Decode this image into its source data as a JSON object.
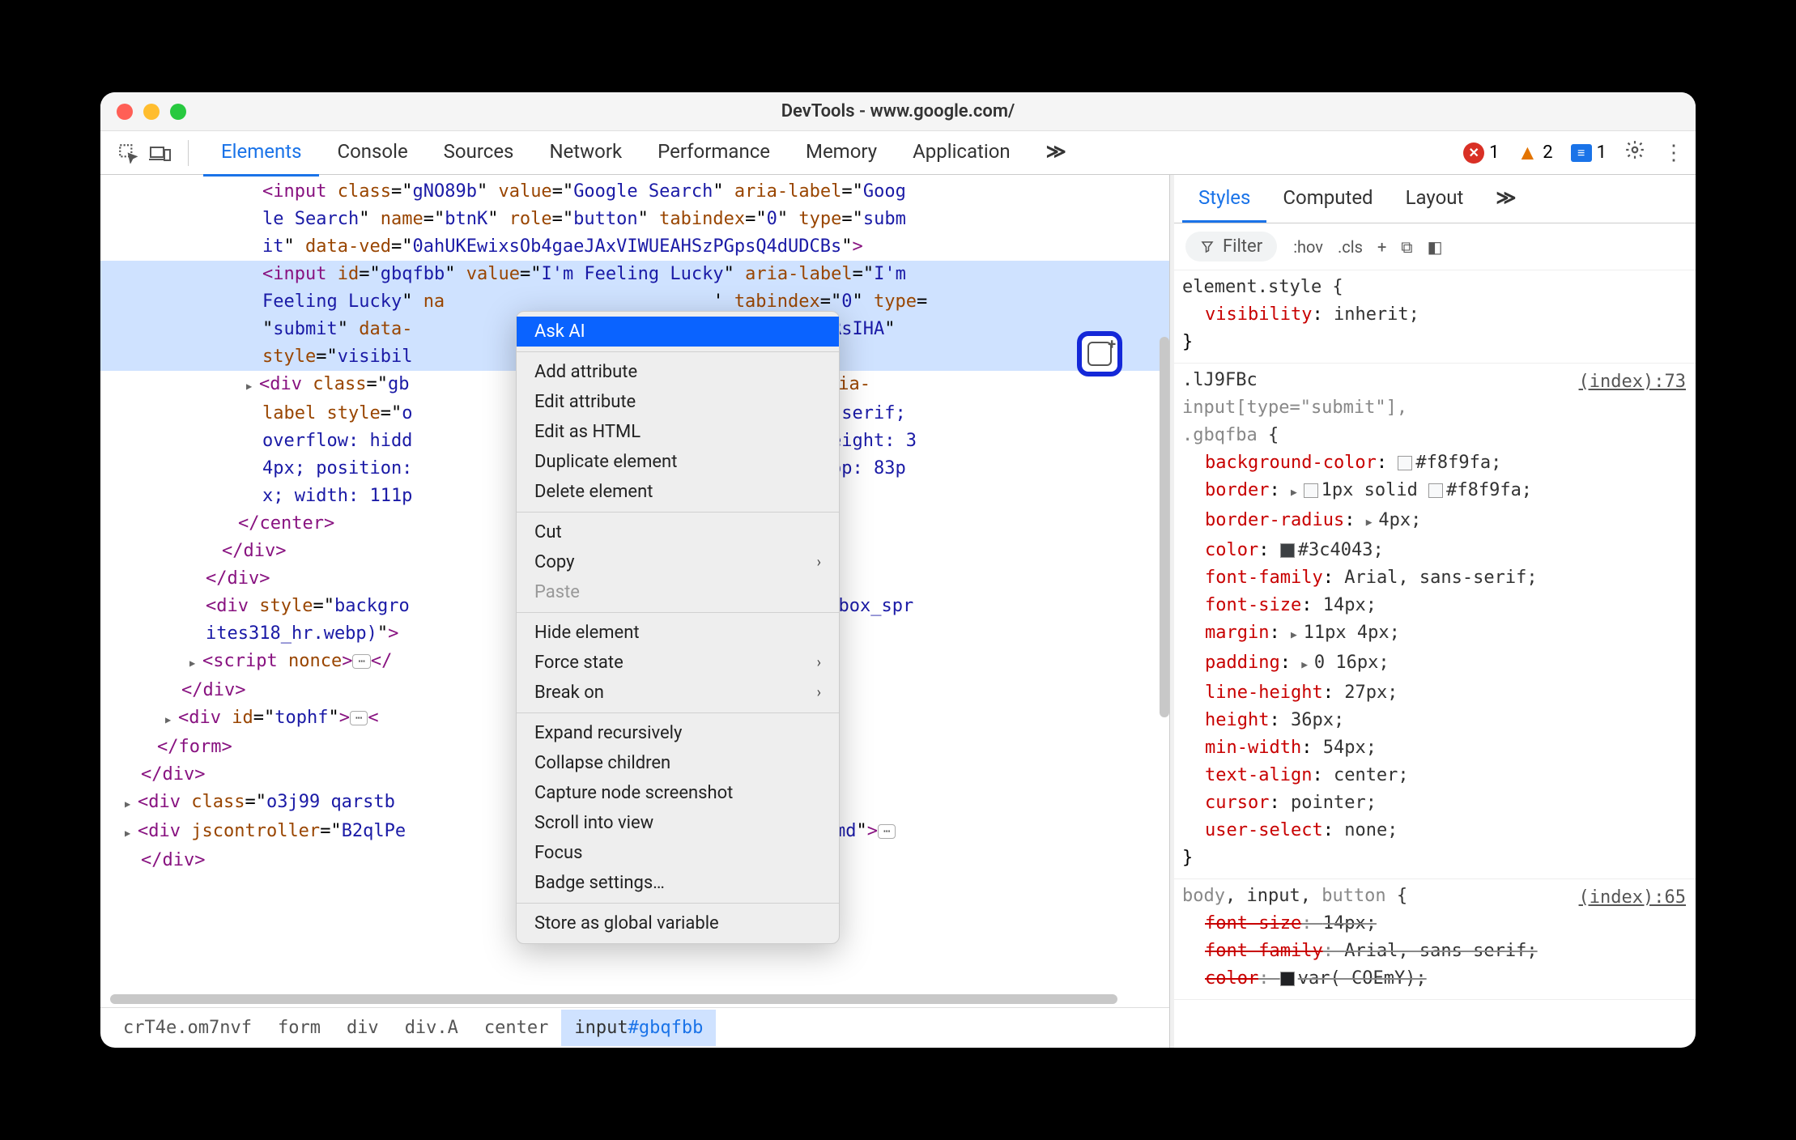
{
  "window": {
    "title": "DevTools - www.google.com/"
  },
  "toolbar": {
    "tabs": [
      "Elements",
      "Console",
      "Sources",
      "Network",
      "Performance",
      "Memory",
      "Application"
    ],
    "active_tab": "Elements",
    "overflow": "≫",
    "errors": 1,
    "warnings": 2,
    "issues": 1
  },
  "dom": {
    "lines": [
      {
        "indent": 200,
        "selected": false,
        "html": "<span class='tok-tag'>&lt;input</span> <span class='tok-attr'>class</span>=\"<span class='tok-val'>gNO89b</span>\" <span class='tok-attr'>value</span>=\"<span class='tok-val'>Google Search</span>\" <span class='tok-attr'>aria-label</span>=\"<span class='tok-val'>Goog</span>"
      },
      {
        "indent": 200,
        "selected": false,
        "html": "<span class='tok-val'>le Search</span>\" <span class='tok-attr'>name</span>=\"<span class='tok-val'>btnK</span>\" <span class='tok-attr'>role</span>=\"<span class='tok-val'>button</span>\" <span class='tok-attr'>tabindex</span>=\"<span class='tok-val'>0</span>\" <span class='tok-attr'>type</span>=\"<span class='tok-val'>subm</span>"
      },
      {
        "indent": 200,
        "selected": false,
        "html": "<span class='tok-val'>it</span>\" <span class='tok-attr'>data-ved</span>=\"<span class='tok-val'>0ahUKEwixsOb4gaeJAxVIWUEAHSzPGpsQ4dUDCBs</span>\"<span class='tok-tag'>&gt;</span>"
      },
      {
        "indent": 200,
        "selected": true,
        "html": "<span class='tok-tag'>&lt;input</span> <span class='tok-attr'>id</span>=\"<span class='tok-val'>gbqfbb</span>\" <span class='tok-attr'>value</span>=\"<span class='tok-val'>I'm Feeling Lucky</span>\" <span class='tok-attr'>aria-label</span>=\"<span class='tok-val'>I'm </span>"
      },
      {
        "indent": 200,
        "selected": true,
        "html": "<span class='tok-val'>Feeling Lucky</span>\" <span class='tok-attr'>na</span>&nbsp;&nbsp;&nbsp;&nbsp;&nbsp;&nbsp;&nbsp;&nbsp;&nbsp;&nbsp;&nbsp;&nbsp;&nbsp;&nbsp;&nbsp;&nbsp;&nbsp;&nbsp;&nbsp;&nbsp;&nbsp;&nbsp;&nbsp;&nbsp;&nbsp;' <span class='tok-attr'>tabindex</span>=\"<span class='tok-val'>0</span>\" <span class='tok-attr'>type</span>="
      },
      {
        "indent": 200,
        "selected": true,
        "html": "\"<span class='tok-val'>submit</span>\" <span class='tok-attr'>data-</span>&nbsp;&nbsp;&nbsp;&nbsp;&nbsp;&nbsp;&nbsp;&nbsp;&nbsp;&nbsp;&nbsp;&nbsp;&nbsp;&nbsp;&nbsp;&nbsp;&nbsp;&nbsp;&nbsp;&nbsp;&nbsp;&nbsp;&nbsp;&nbsp;&nbsp;<span class='tok-val'>IWUEAHSzPGpsQnRsIHA</span>\""
      },
      {
        "indent": 200,
        "selected": true,
        "html": "<span class='tok-attr'>style</span>=\"<span class='tok-val'>visibil</span>"
      },
      {
        "indent": 180,
        "selected": false,
        "html": "<span class='caret'></span><span class='tok-tag'>&lt;div</span> <span class='tok-attr'>class</span>=\"<span class='tok-val'>gb</span>&nbsp;&nbsp;&nbsp;&nbsp;&nbsp;&nbsp;&nbsp;&nbsp;&nbsp;&nbsp;&nbsp;&nbsp;&nbsp;&nbsp;&nbsp;&nbsp;&nbsp;&nbsp;&nbsp;&nbsp;&nbsp;&nbsp;&nbsp;&nbsp;&nbsp;&nbsp;<span class='tok-val'>esentation</span>\" <span class='tok-attr'>aria-</span>"
      },
      {
        "indent": 200,
        "selected": false,
        "html": "<span class='tok-attr'>label</span> <span class='tok-attr'>style</span>=\"<span class='tok-val'>o</span>&nbsp;&nbsp;&nbsp;&nbsp;&nbsp;&nbsp;&nbsp;&nbsp;&nbsp;&nbsp;&nbsp;&nbsp;&nbsp;&nbsp;&nbsp;&nbsp;&nbsp;&nbsp;&nbsp;&nbsp;&nbsp;&nbsp;&nbsp;&nbsp;&nbsp;&nbsp;<span class='tok-val'>: Arial, sans-serif;</span>"
      },
      {
        "indent": 200,
        "selected": false,
        "html": "<span class='tok-val'>overflow: hidd</span>&nbsp;&nbsp;&nbsp;&nbsp;&nbsp;&nbsp;&nbsp;&nbsp;&nbsp;&nbsp;&nbsp;&nbsp;&nbsp;&nbsp;&nbsp;&nbsp;&nbsp;&nbsp;&nbsp;&nbsp;&nbsp;&nbsp;&nbsp;&nbsp;&nbsp;&nbsp;<span class='tok-val'>-index: 50; height: 3</span>"
      },
      {
        "indent": 200,
        "selected": false,
        "html": "<span class='tok-val'>4px; position:</span>&nbsp;&nbsp;&nbsp;&nbsp;&nbsp;&nbsp;&nbsp;&nbsp;&nbsp;&nbsp;&nbsp;&nbsp;&nbsp;&nbsp;&nbsp;&nbsp;&nbsp;&nbsp;&nbsp;&nbsp;&nbsp;&nbsp;&nbsp;&nbsp;&nbsp;&nbsp;<span class='tok-val'>argin: 0px; top: 83p</span>"
      },
      {
        "indent": 200,
        "selected": false,
        "html": "<span class='tok-val'>x; width: 111p</span>"
      },
      {
        "indent": 170,
        "selected": false,
        "html": "<span class='tok-tag'>&lt;/center&gt;</span>"
      },
      {
        "indent": 150,
        "selected": false,
        "html": "<span class='tok-tag'>&lt;/div&gt;</span>"
      },
      {
        "indent": 130,
        "selected": false,
        "html": "<span class='tok-tag'>&lt;/div&gt;</span>"
      },
      {
        "indent": 130,
        "selected": false,
        "html": "<span class='tok-tag'>&lt;div</span> <span class='tok-attr'>style</span>=\"<span class='tok-val'>backgro</span>&nbsp;&nbsp;&nbsp;&nbsp;&nbsp;&nbsp;&nbsp;&nbsp;&nbsp;&nbsp;&nbsp;&nbsp;&nbsp;&nbsp;&nbsp;&nbsp;&nbsp;&nbsp;&nbsp;&nbsp;&nbsp;&nbsp;&nbsp;&nbsp;&nbsp;&nbsp;<span class='tok-val'>desktop_searchbox_spr</span>"
      },
      {
        "indent": 130,
        "selected": false,
        "html": "<span class='tok-val'>ites318_hr.webp)</span>\"<span class='tok-tag'>&gt;</span> <span class='tok-text'></span>"
      },
      {
        "indent": 110,
        "selected": false,
        "html": "<span class='caret'></span><span class='tok-tag'>&lt;script</span> <span class='tok-attr'>nonce</span><span class='tok-tag'>&gt;</span><span class='ell'>⋯</span><span class='tok-tag'>&lt;/</span>"
      },
      {
        "indent": 100,
        "selected": false,
        "html": "<span class='tok-tag'>&lt;/div&gt;</span>"
      },
      {
        "indent": 80,
        "selected": false,
        "html": "<span class='caret'></span><span class='tok-tag'>&lt;div</span> <span class='tok-attr'>id</span>=\"<span class='tok-val'>tophf</span>\"<span class='tok-tag'>&gt;</span><span class='ell'>⋯</span><span class='tok-tag'>&lt;</span>"
      },
      {
        "indent": 70,
        "selected": false,
        "html": "<span class='tok-tag'>&lt;/form&gt;</span>"
      },
      {
        "indent": 50,
        "selected": false,
        "html": "<span class='tok-tag'>&lt;/div&gt;</span>"
      },
      {
        "indent": 30,
        "selected": false,
        "html": "<span class='caret'></span><span class='tok-tag'>&lt;div</span> <span class='tok-attr'>class</span>=\"<span class='tok-val'>o3j99 qarstb</span>"
      },
      {
        "indent": 30,
        "selected": false,
        "html": "<span class='caret'></span><span class='tok-tag'>&lt;div</span> <span class='tok-attr'>jscontroller</span>=\"<span class='tok-val'>B2qlPe</span>&nbsp;&nbsp;&nbsp;&nbsp;&nbsp;&nbsp;&nbsp;&nbsp;&nbsp;&nbsp;&nbsp;&nbsp;&nbsp;&nbsp;&nbsp;&nbsp;&nbsp;&nbsp;&nbsp;&nbsp;&nbsp;&nbsp;&nbsp;&nbsp;&nbsp;&nbsp;<span class='tok-attr'>n</span>=\"<span class='tok-val'>rcuQ6b:npT2md</span>\"<span class='tok-tag'>&gt;</span><span class='ell'>⋯</span>"
      },
      {
        "indent": 50,
        "selected": false,
        "html": "<span class='tok-tag'>&lt;/div&gt;</span>"
      }
    ]
  },
  "context_menu": {
    "items": [
      {
        "label": "Ask AI",
        "state": "highlighted"
      },
      {
        "sep": true
      },
      {
        "label": "Add attribute"
      },
      {
        "label": "Edit attribute"
      },
      {
        "label": "Edit as HTML"
      },
      {
        "label": "Duplicate element"
      },
      {
        "label": "Delete element"
      },
      {
        "sep": true
      },
      {
        "label": "Cut"
      },
      {
        "label": "Copy",
        "submenu": true
      },
      {
        "label": "Paste",
        "state": "disabled"
      },
      {
        "sep": true
      },
      {
        "label": "Hide element"
      },
      {
        "label": "Force state",
        "submenu": true
      },
      {
        "label": "Break on",
        "submenu": true
      },
      {
        "sep": true
      },
      {
        "label": "Expand recursively"
      },
      {
        "label": "Collapse children"
      },
      {
        "label": "Capture node screenshot"
      },
      {
        "label": "Scroll into view"
      },
      {
        "label": "Focus"
      },
      {
        "label": "Badge settings…"
      },
      {
        "sep": true
      },
      {
        "label": "Store as global variable"
      }
    ]
  },
  "breadcrumbs": [
    {
      "text": "crT4e.om7nvf"
    },
    {
      "text": "form"
    },
    {
      "text": "div"
    },
    {
      "text": "div.A"
    },
    {
      "text": "center"
    },
    {
      "text": "input",
      "id": "#gbqfbb",
      "active": true
    }
  ],
  "styles": {
    "tabs": [
      "Styles",
      "Computed",
      "Layout"
    ],
    "active_tab": "Styles",
    "overflow": "≫",
    "filter_label": "Filter",
    "tools": [
      ":hov",
      ".cls",
      "+",
      "⧉",
      "◧"
    ],
    "rules": [
      {
        "selector_html": "element.style {",
        "props": [
          {
            "name": "visibility",
            "val": "inherit;"
          }
        ],
        "close": "}"
      },
      {
        "src": "(index):73",
        "selector_html": ".lJ9FBc<br><span class='dim'>input[type=\"submit\"],</span><br><span class='dim'>.gbqfba</span> {",
        "props": [
          {
            "name": "background-color",
            "val": "#f8f9fa;",
            "swatch": "#f8f9fa"
          },
          {
            "name": "border",
            "val": "1px solid ",
            "swatch": "#f8f9fa",
            "post": "#f8f9fa;",
            "tri": true
          },
          {
            "name": "border-radius",
            "val": "4px;",
            "tri": true
          },
          {
            "name": "color",
            "val": "#3c4043;",
            "swatch": "#3c4043"
          },
          {
            "name": "font-family",
            "val": "Arial, sans-serif;"
          },
          {
            "name": "font-size",
            "val": "14px;"
          },
          {
            "name": "margin",
            "val": "11px 4px;",
            "tri": true
          },
          {
            "name": "padding",
            "val": "0 16px;",
            "tri": true
          },
          {
            "name": "line-height",
            "val": "27px;"
          },
          {
            "name": "height",
            "val": "36px;"
          },
          {
            "name": "min-width",
            "val": "54px;"
          },
          {
            "name": "text-align",
            "val": "center;"
          },
          {
            "name": "cursor",
            "val": "pointer;"
          },
          {
            "name": "user-select",
            "val": "none;"
          }
        ],
        "close": "}"
      },
      {
        "src": "(index):65",
        "selector_html": "<span class='dim'>body</span>, input, <span class='dim'>button</span> {",
        "props": [
          {
            "name": "font-size",
            "val": "14px;",
            "struck": true
          },
          {
            "name": "font-family",
            "val": "Arial, sans-serif;",
            "struck": true
          },
          {
            "name": "color",
            "val": "var(  COEmY);",
            "swatch": "#202124",
            "struck": true
          }
        ]
      }
    ]
  }
}
